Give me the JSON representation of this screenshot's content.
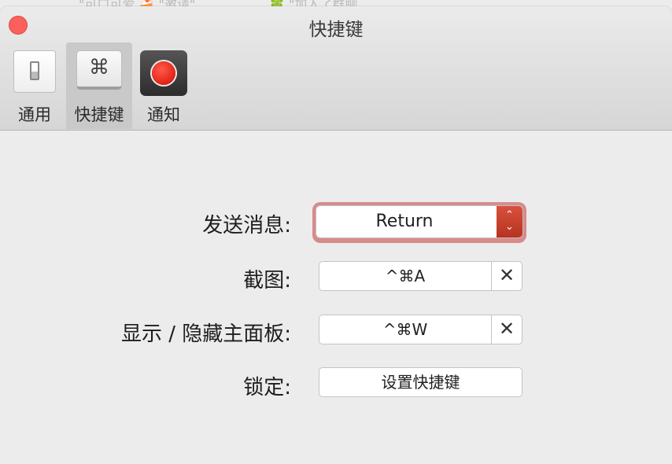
{
  "background_window": {
    "text_left": "\"可口可爱 🍰 \"邀请\"",
    "text_right": "🍀 \"加入了群聊"
  },
  "window": {
    "title": "快捷键"
  },
  "toolbar": {
    "tabs": [
      {
        "label": "通用",
        "icon": "toggle-switch-icon",
        "selected": false
      },
      {
        "label": "快捷键",
        "icon": "command-key-icon",
        "glyph": "⌘",
        "selected": true
      },
      {
        "label": "通知",
        "icon": "record-dot-icon",
        "selected": false
      }
    ]
  },
  "settings": {
    "send_message": {
      "label": "发送消息:",
      "value": "Return",
      "stepper_up": "⌃",
      "stepper_down": "⌄"
    },
    "screenshot": {
      "label": "截图:",
      "value": "^⌘A",
      "clear_glyph": "✕"
    },
    "toggle_panel": {
      "label": "显示 / 隐藏主面板:",
      "value": "^⌘W",
      "clear_glyph": "✕"
    },
    "lock": {
      "label": "锁定:",
      "button_label": "设置快捷键"
    }
  },
  "colors": {
    "close_button": "#fc605c",
    "select_focus_ring": "#d88b8b",
    "stepper": "#c0402b"
  }
}
